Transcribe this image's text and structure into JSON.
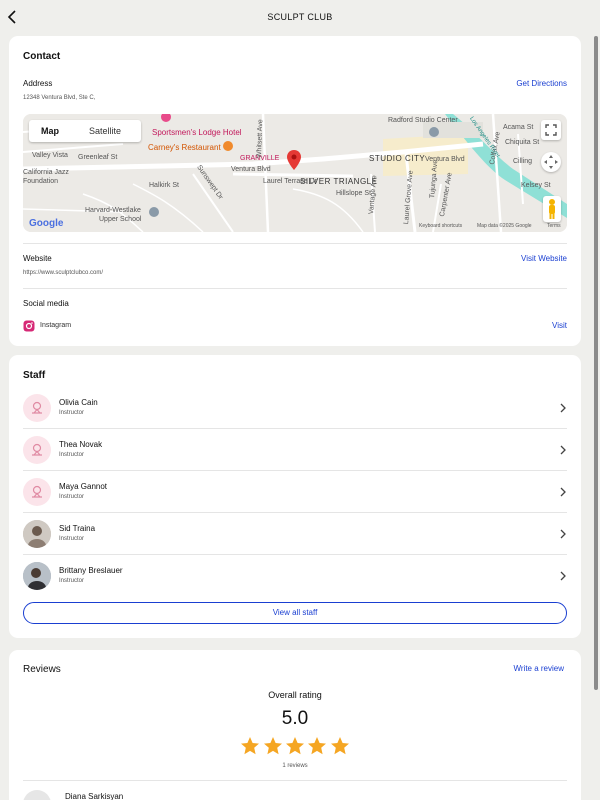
{
  "header": {
    "title": "SCULPT CLUB"
  },
  "contact": {
    "heading": "Contact",
    "address_label": "Address",
    "address_value": "12348 Ventura Blvd, Ste C,",
    "directions_link": "Get Directions",
    "map": {
      "map_tab": "Map",
      "satellite_tab": "Satellite",
      "labels": {
        "radford": "Radford Studio Center",
        "sportsmen": "Sportsmen's Lodge Hotel",
        "carneys": "Carney's Restaurant",
        "granville": "GRANVILLE",
        "studio_city": "STUDIO CITY",
        "silver_triangle": "SILVER TRIANGLE",
        "ventura_blvd_left": "Ventura Blvd",
        "ventura_blvd_right": "Ventura Blvd",
        "halkirk": "Halkirk St",
        "harvard": "Harvard-Westlake",
        "upper_school": "Upper School",
        "valley_vista": "Valley Vista",
        "greenleaf": "Greenleaf St",
        "california_jazz": "California Jazz",
        "foundation": "Foundation",
        "laurel_terrace": "Laurel Terrace Dr",
        "hillslope": "Hillslope St",
        "acama": "Acama St",
        "chiquita": "Chiquita St",
        "cilling": "Cilling",
        "kelsey": "Kelsey St",
        "colfax": "Colfax Ave",
        "tujunga": "Tujunga Ave",
        "laurel_grove": "Laurel Grove Ave",
        "carpenter": "Carpenter Ave",
        "vantage": "Vantage Ave",
        "whitsett": "Whitsett Ave",
        "sunswept": "Sunswept Dr",
        "la_river": "Los Angeles River",
        "google": "Google",
        "shortcuts": "Keyboard shortcuts",
        "mapdata": "Map data ©2025 Google",
        "terms": "Terms"
      }
    },
    "website_label": "Website",
    "website_value": "https://www.sculptclubco.com/",
    "website_link": "Visit Website",
    "social_label": "Social media",
    "social_name": "Instagram",
    "social_link": "Visit"
  },
  "staff": {
    "heading": "Staff",
    "members": [
      {
        "name": "Olivia Cain",
        "role": "Instructor",
        "avatar": "placeholder-icon"
      },
      {
        "name": "Thea Novak",
        "role": "Instructor",
        "avatar": "placeholder-icon"
      },
      {
        "name": "Maya Gannot",
        "role": "Instructor",
        "avatar": "placeholder-icon"
      },
      {
        "name": "Sid Traina",
        "role": "Instructor",
        "avatar": "photo"
      },
      {
        "name": "Brittany Breslauer",
        "role": "Instructor",
        "avatar": "photo"
      }
    ],
    "view_all": "View all staff"
  },
  "reviews": {
    "heading": "Reviews",
    "write_link": "Write a review",
    "overall_label": "Overall rating",
    "rating": "5.0",
    "stars": 5,
    "count_text": "1 reviews",
    "first_reviewer": "Diana Sarkisyan"
  },
  "colors": {
    "accent": "#1a3fd1",
    "star": "#f5a623",
    "pin": "#e53935",
    "avatar_bg": "#fbe4ea"
  }
}
